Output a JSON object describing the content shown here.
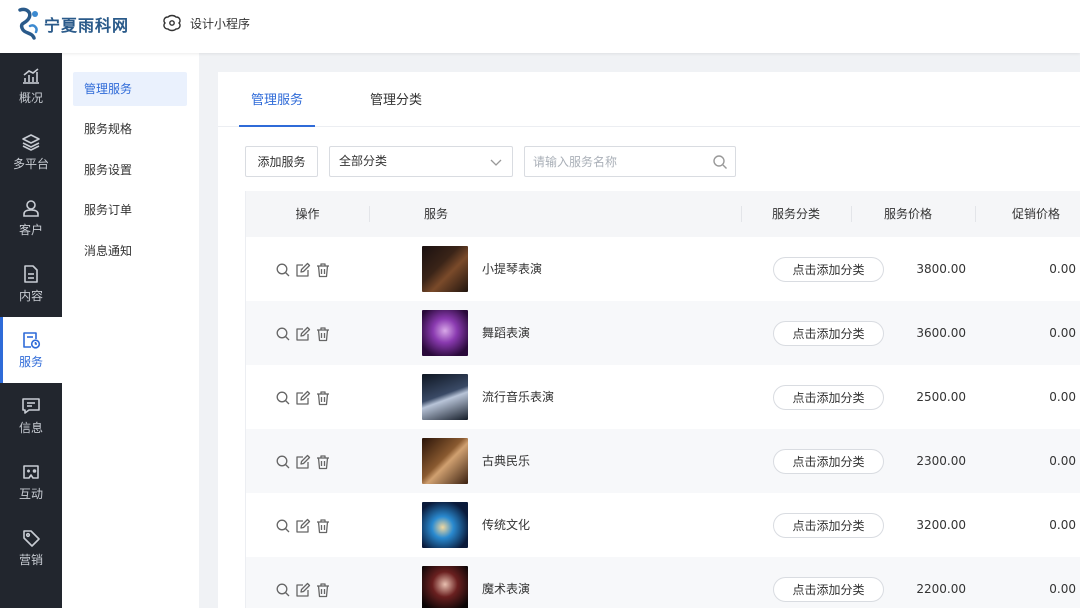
{
  "brand": {
    "name": "宁夏雨科网"
  },
  "header": {
    "design_link": "设计小程序"
  },
  "rail": [
    {
      "key": "overview",
      "label": "概况",
      "icon": "chart-up-icon"
    },
    {
      "key": "platforms",
      "label": "多平台",
      "icon": "layers-icon"
    },
    {
      "key": "customers",
      "label": "客户",
      "icon": "user-icon"
    },
    {
      "key": "content",
      "label": "内容",
      "icon": "document-icon"
    },
    {
      "key": "services",
      "label": "服务",
      "icon": "service-clock-icon",
      "active": true
    },
    {
      "key": "messages",
      "label": "信息",
      "icon": "message-icon"
    },
    {
      "key": "interaction",
      "label": "互动",
      "icon": "gamepad-icon"
    },
    {
      "key": "marketing",
      "label": "营销",
      "icon": "tag-icon"
    }
  ],
  "submenu": [
    {
      "label": "管理服务",
      "active": true
    },
    {
      "label": "服务规格"
    },
    {
      "label": "服务设置"
    },
    {
      "label": "服务订单"
    },
    {
      "label": "消息通知"
    }
  ],
  "tabs": [
    {
      "label": "管理服务",
      "active": true
    },
    {
      "label": "管理分类"
    }
  ],
  "toolbar": {
    "add_label": "添加服务",
    "category_selected": "全部分类",
    "search_placeholder": "请输入服务名称"
  },
  "table": {
    "columns": [
      "操作",
      "服务",
      "服务分类",
      "服务价格",
      "促销价格"
    ],
    "category_button": "点击添加分类",
    "rows": [
      {
        "name": "小提琴表演",
        "price": "3800.00",
        "promo": "0.00"
      },
      {
        "name": "舞蹈表演",
        "price": "3600.00",
        "promo": "0.00"
      },
      {
        "name": "流行音乐表演",
        "price": "2500.00",
        "promo": "0.00"
      },
      {
        "name": "古典民乐",
        "price": "2300.00",
        "promo": "0.00"
      },
      {
        "name": "传统文化",
        "price": "3200.00",
        "promo": "0.00"
      },
      {
        "name": "魔术表演",
        "price": "2200.00",
        "promo": "0.00"
      }
    ]
  },
  "colors": {
    "accent": "#2f6bd8",
    "rail_bg": "#22262e",
    "page_bg": "#f0f2f5"
  }
}
